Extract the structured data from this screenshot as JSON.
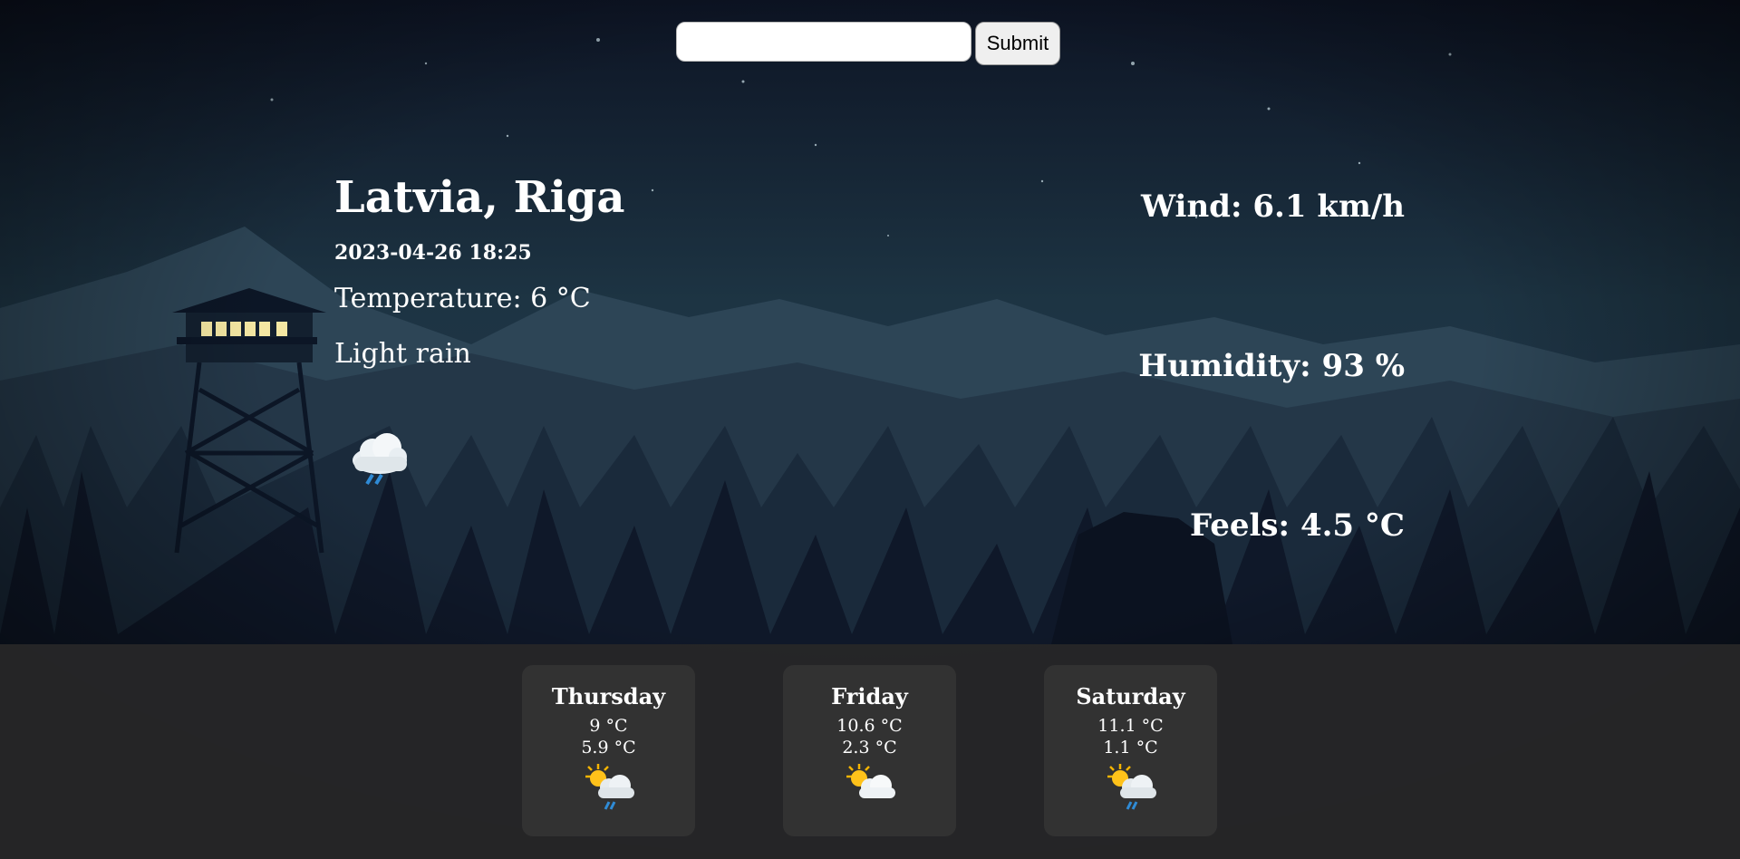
{
  "search": {
    "placeholder": "",
    "value": "",
    "submit_label": "Submit"
  },
  "current": {
    "location": "Latvia, Riga",
    "datetime": "2023-04-26 18:25",
    "temperature": "Temperature: 6 °C",
    "description": "Light rain",
    "icon": "cloud-rain-icon",
    "wind": "Wind: 6.1 km/h",
    "humidity": "Humidity: 93 %",
    "feels": "Feels: 4.5 °C"
  },
  "forecast": [
    {
      "day": "Thursday",
      "high": "9 °C",
      "low": "5.9 °C",
      "icon": "sun-cloud-rain-icon"
    },
    {
      "day": "Friday",
      "high": "10.6 °C",
      "low": "2.3 °C",
      "icon": "sun-cloud-icon"
    },
    {
      "day": "Saturday",
      "high": "11.1 °C",
      "low": "1.1 °C",
      "icon": "sun-cloud-rain-icon"
    }
  ],
  "colors": {
    "sky_top": "#0e1626",
    "sky_mid": "#1f3a4a",
    "footer": "#262628",
    "card": "#323232"
  }
}
